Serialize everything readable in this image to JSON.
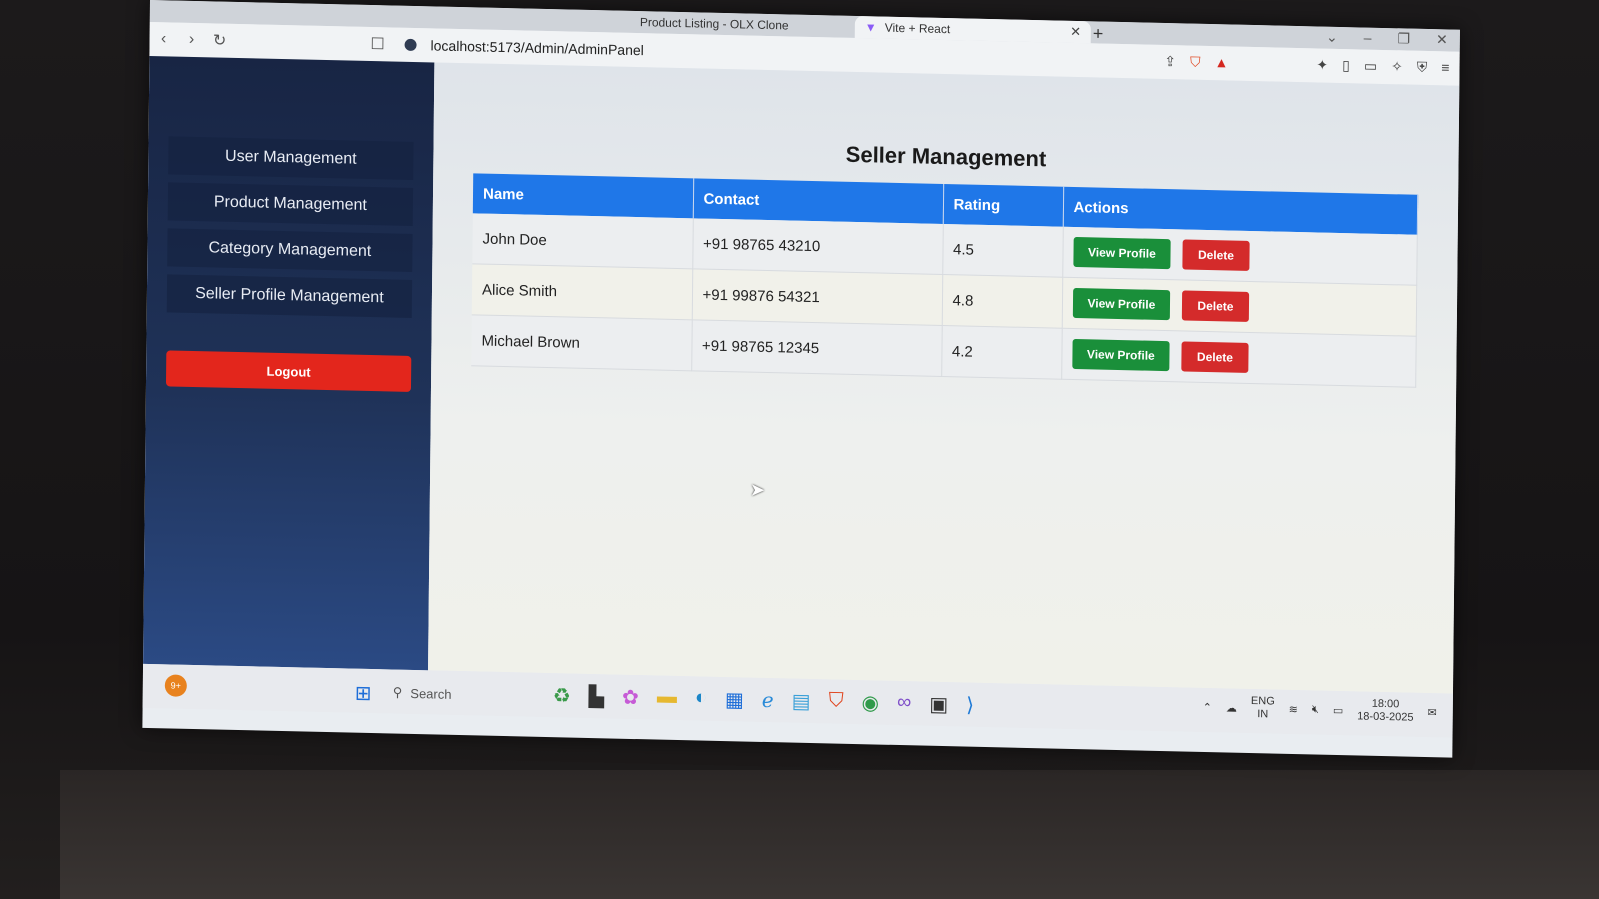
{
  "browser": {
    "tabs": [
      {
        "label": "Product Listing - OLX Clone",
        "active": false
      },
      {
        "label": "Vite + React",
        "active": true
      }
    ],
    "url": "localhost:5173/Admin/AdminPanel"
  },
  "sidebar": {
    "items": [
      {
        "label": "User Management"
      },
      {
        "label": "Product Management"
      },
      {
        "label": "Category Management"
      },
      {
        "label": "Seller Profile Management"
      }
    ],
    "logout_label": "Logout"
  },
  "main": {
    "title": "Seller Management",
    "table": {
      "headers": [
        "Name",
        "Contact",
        "Rating",
        "Actions"
      ],
      "rows": [
        {
          "name": "John Doe",
          "contact": "+91 98765 43210",
          "rating": "4.5"
        },
        {
          "name": "Alice Smith",
          "contact": "+91 99876 54321",
          "rating": "4.8"
        },
        {
          "name": "Michael Brown",
          "contact": "+91 98765 12345",
          "rating": "4.2"
        }
      ],
      "view_label": "View Profile",
      "delete_label": "Delete"
    }
  },
  "taskbar": {
    "badge": "9+",
    "search_placeholder": "Search",
    "language": "ENG",
    "region": "IN",
    "time": "18:00",
    "date": "18-03-2025"
  },
  "colors": {
    "header_blue": "#1f77e8",
    "view_green": "#1a8f3a",
    "delete_red": "#d42b2b",
    "logout_red": "#e3261c",
    "sidebar_navy": "#1f3258"
  }
}
